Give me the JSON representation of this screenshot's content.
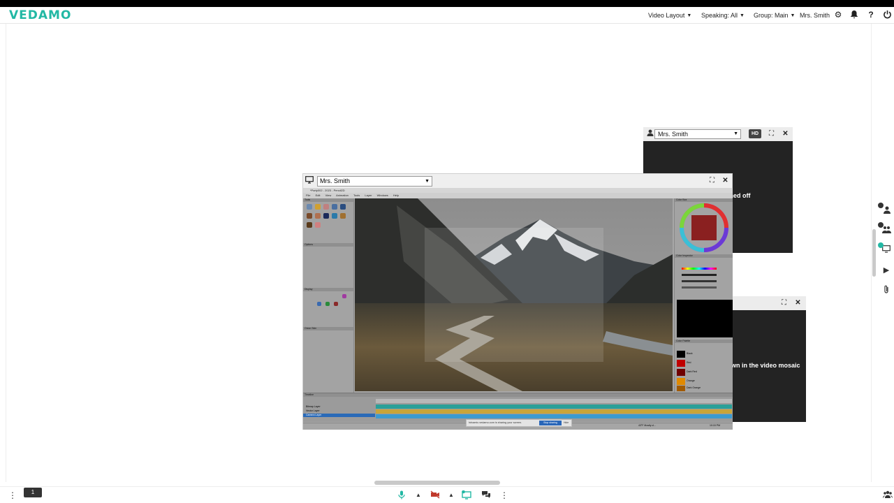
{
  "brand": {
    "logo": "VEDAMO",
    "accent": "#22b8a4"
  },
  "topbar": {
    "video_layout": "Video Layout",
    "speaking": "Speaking: All",
    "group": "Group: Main",
    "user": "Mrs. Smith",
    "icons": [
      "gear-icon",
      "bell-icon",
      "help-icon",
      "power-icon"
    ]
  },
  "tile_top": {
    "participant": "Mrs. Smith",
    "hd_label": "HD",
    "status_text": "rned off"
  },
  "tile_bottom": {
    "status_text": "wn in the video mosaic"
  },
  "share": {
    "participant": "Mrs. Smith",
    "app_title": "*Party002 - 2023 - Pencil2D",
    "menu": [
      "File",
      "Edit",
      "View",
      "Animation",
      "Tools",
      "Layer",
      "Windows",
      "Help"
    ],
    "left_panels": [
      "Tools",
      "Options",
      "Display",
      "Onion Skin"
    ],
    "right_panels": [
      "Color Box",
      "Color Inspector",
      "Color Palette"
    ],
    "palette": [
      {
        "name": "Black",
        "color": "#000000"
      },
      {
        "name": "Red",
        "color": "#c00000"
      },
      {
        "name": "Dark Red",
        "color": "#700000"
      },
      {
        "name": "Orange",
        "color": "#e08a00"
      },
      {
        "name": "Dark Orange",
        "color": "#a05a00"
      }
    ],
    "timeline_label": "Timeline",
    "layers": [
      "Bitmap Layer",
      "Vector Layer",
      "Camera Layer"
    ],
    "notice_text": "hdvamic.vedamo.com is sharing your screen.",
    "stop_label": "Stop sharing",
    "hide_label": "Hide",
    "taskbar_weather": "43°F  Mostly cl...",
    "taskbar_time": "10:15 PM"
  },
  "bottombar": {
    "page_number": "1",
    "icons": [
      "more-vertical-icon",
      "microphone-icon",
      "camera-off-icon",
      "screen-share-icon",
      "chat-icon",
      "more-options-icon",
      "participants-icon"
    ]
  },
  "rightrail": {
    "icons": [
      "add-user-icon",
      "group-icon",
      "screen-icon",
      "play-icon",
      "attachment-icon"
    ]
  }
}
